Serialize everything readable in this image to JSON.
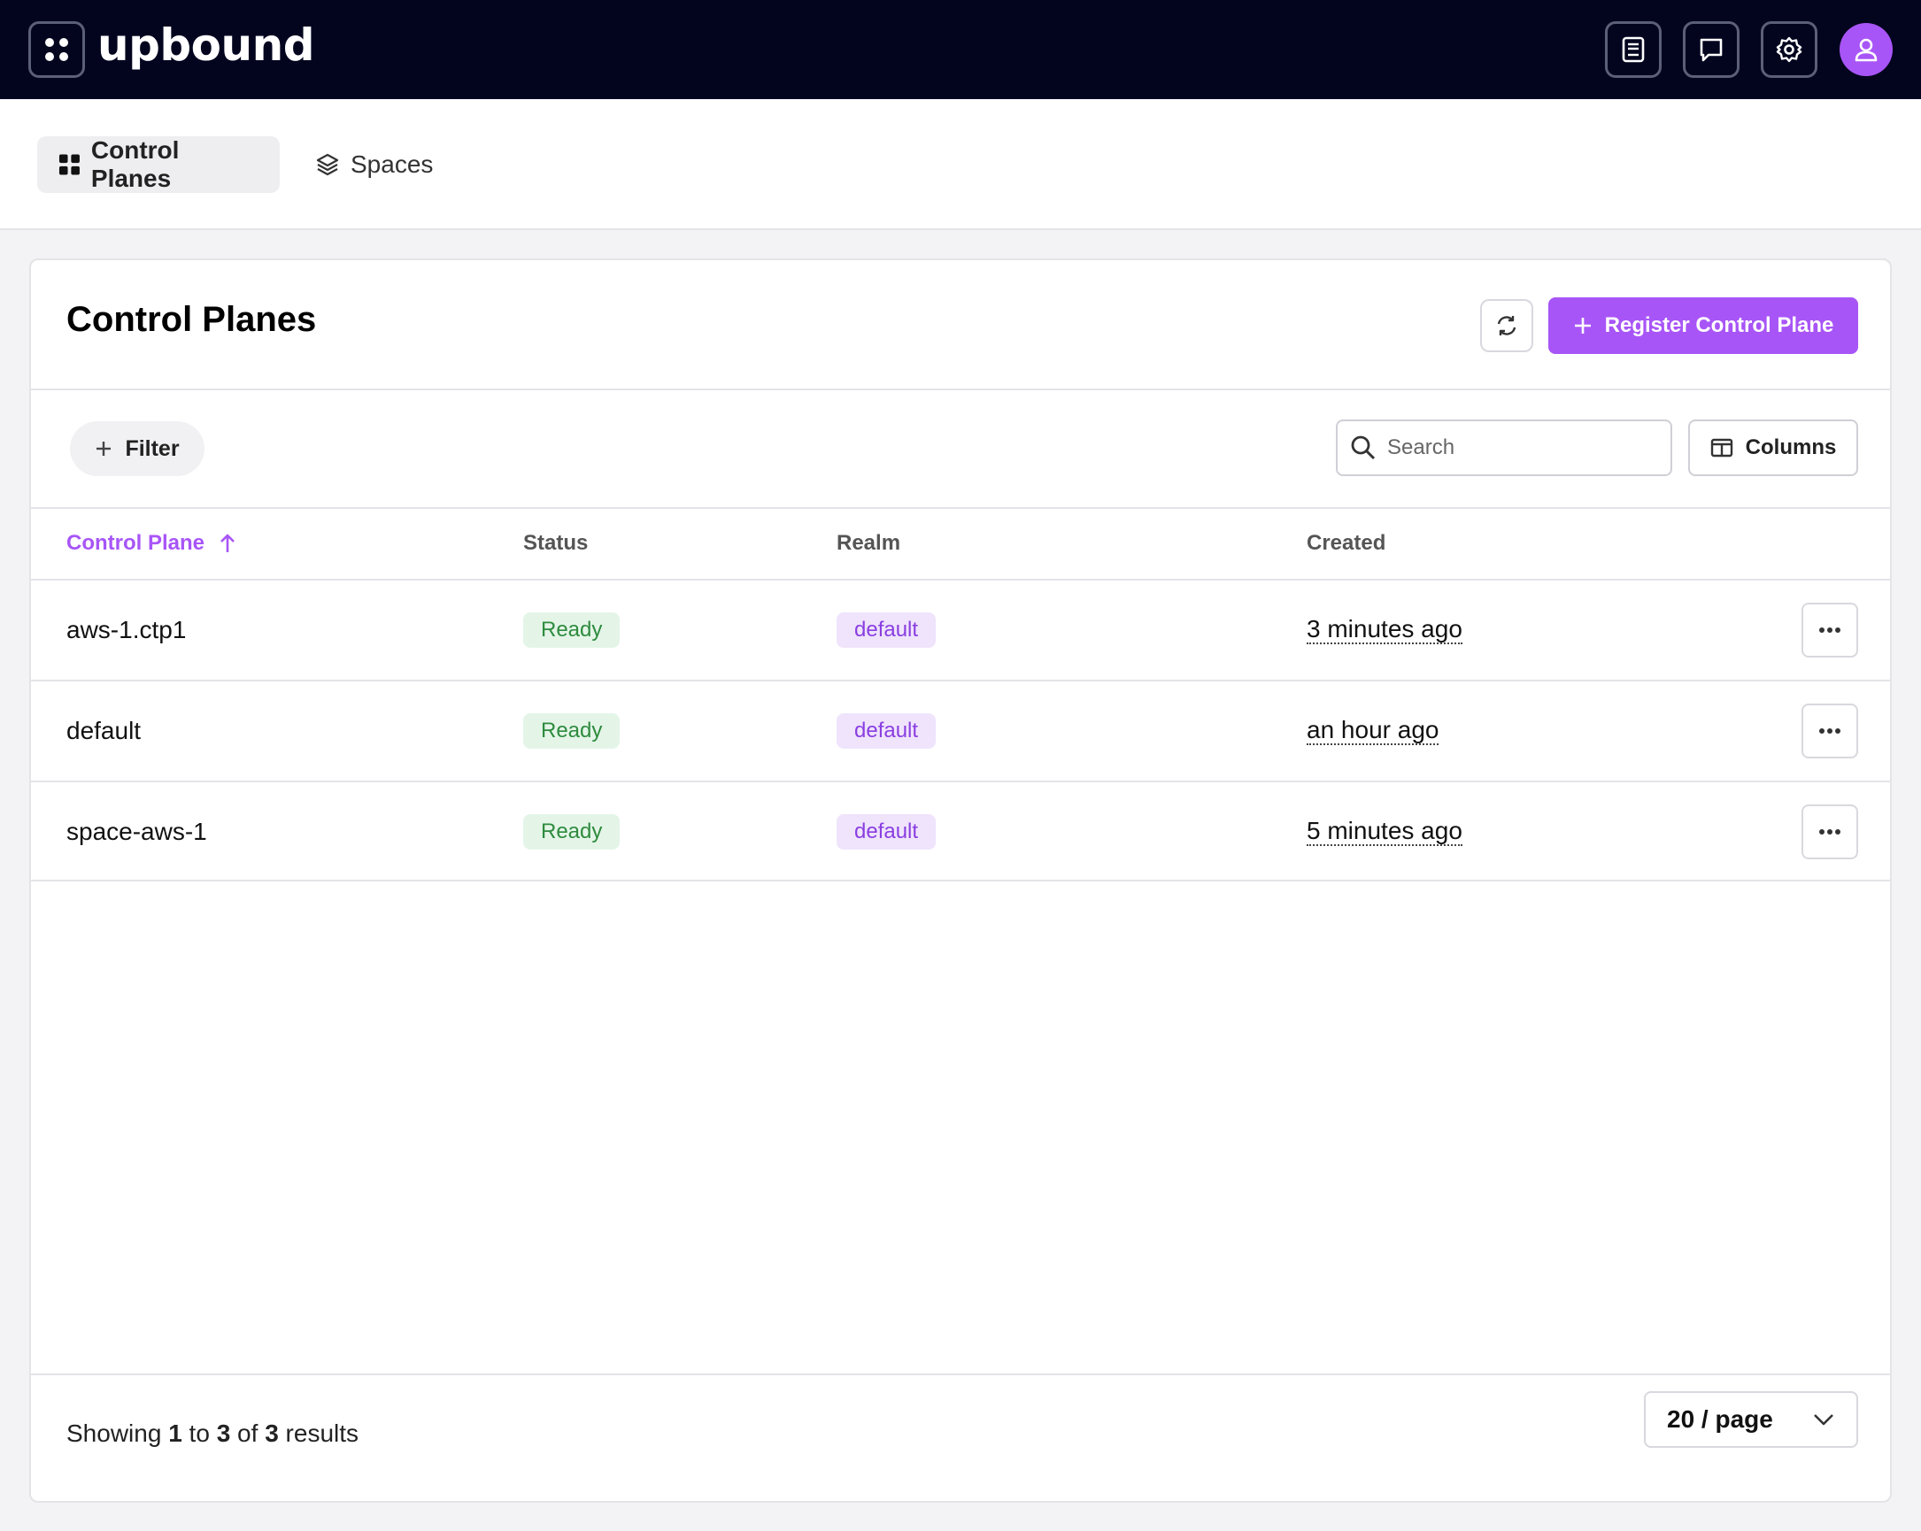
{
  "app": {
    "logo": "upbound"
  },
  "topbar": {
    "icons": [
      "docs-icon",
      "chat-icon",
      "settings-icon",
      "user-icon"
    ]
  },
  "nav": {
    "tabs": [
      {
        "label": "Control Planes",
        "active": true,
        "icon": "grid-icon"
      },
      {
        "label": "Spaces",
        "active": false,
        "icon": "layers-icon"
      }
    ]
  },
  "page": {
    "title": "Control Planes",
    "register_label": "Register Control Plane",
    "filter_label": "Filter",
    "search_placeholder": "Search",
    "columns_label": "Columns"
  },
  "table": {
    "headers": [
      "Control Plane",
      "Status",
      "Realm",
      "Created"
    ],
    "rows": [
      {
        "name": "aws-1.ctp1",
        "status": "Ready",
        "realm": "default",
        "created": "3 minutes ago"
      },
      {
        "name": "default",
        "status": "Ready",
        "realm": "default",
        "created": "an hour ago"
      },
      {
        "name": "space-aws-1",
        "status": "Ready",
        "realm": "default",
        "created": "5 minutes ago"
      }
    ]
  },
  "footer": {
    "showing_prefix": "Showing",
    "from": "1",
    "to_word": "to",
    "to": "3",
    "of_word": "of",
    "total": "3",
    "results_word": "results",
    "page_size": "20 / page"
  },
  "colors": {
    "accent": "#a855f7",
    "topbar": "#03051f",
    "ready_bg": "#e4f5e8",
    "ready_text": "#2e8b3e",
    "realm_bg": "#efe4fc",
    "realm_text": "#8a3ee0"
  }
}
